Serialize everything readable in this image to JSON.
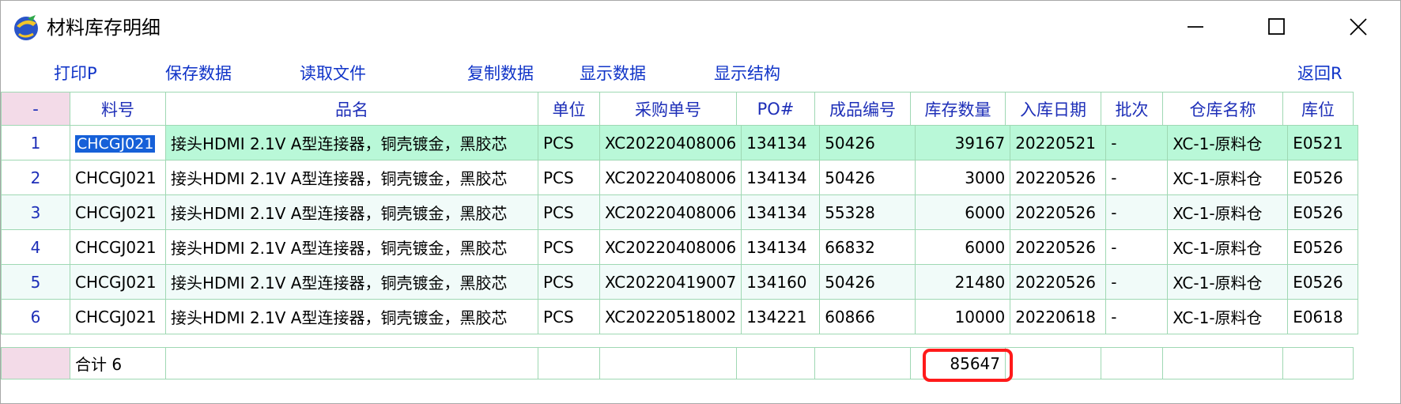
{
  "window": {
    "title": "材料库存明细"
  },
  "toolbar": [
    {
      "label": "打印P"
    },
    {
      "label": "保存数据"
    },
    {
      "label": "读取文件"
    },
    {
      "label": "复制数据"
    },
    {
      "label": "显示数据"
    },
    {
      "label": "显示结构"
    },
    {
      "label": "返回R"
    }
  ],
  "table": {
    "corner": "-",
    "columns": [
      "料号",
      "品名",
      "单位",
      "采购单号",
      "PO#",
      "成品编号",
      "库存数量",
      "入库日期",
      "批次",
      "仓库名称",
      "库位"
    ],
    "rows": [
      {
        "n": "1",
        "part": "CHCGJ021",
        "name": "接头HDMI 2.1V A型连接器，铜壳镀金，黑胶芯",
        "unit": "PCS",
        "po_no": "XC20220408006",
        "po": "134134",
        "product": "50426",
        "qty": "39167",
        "date": "20220521",
        "batch": "-",
        "wh": "XC-1-原料仓",
        "loc": "E0521"
      },
      {
        "n": "2",
        "part": "CHCGJ021",
        "name": "接头HDMI 2.1V A型连接器，铜壳镀金，黑胶芯",
        "unit": "PCS",
        "po_no": "XC20220408006",
        "po": "134134",
        "product": "50426",
        "qty": "3000",
        "date": "20220526",
        "batch": "-",
        "wh": "XC-1-原料仓",
        "loc": "E0526"
      },
      {
        "n": "3",
        "part": "CHCGJ021",
        "name": "接头HDMI 2.1V A型连接器，铜壳镀金，黑胶芯",
        "unit": "PCS",
        "po_no": "XC20220408006",
        "po": "134134",
        "product": "55328",
        "qty": "6000",
        "date": "20220526",
        "batch": "-",
        "wh": "XC-1-原料仓",
        "loc": "E0526"
      },
      {
        "n": "4",
        "part": "CHCGJ021",
        "name": "接头HDMI 2.1V A型连接器，铜壳镀金，黑胶芯",
        "unit": "PCS",
        "po_no": "XC20220408006",
        "po": "134134",
        "product": "66832",
        "qty": "6000",
        "date": "20220526",
        "batch": "-",
        "wh": "XC-1-原料仓",
        "loc": "E0526"
      },
      {
        "n": "5",
        "part": "CHCGJ021",
        "name": "接头HDMI 2.1V A型连接器，铜壳镀金，黑胶芯",
        "unit": "PCS",
        "po_no": "XC20220419007",
        "po": "134160",
        "product": "50426",
        "qty": "21480",
        "date": "20220526",
        "batch": "-",
        "wh": "XC-1-原料仓",
        "loc": "E0526"
      },
      {
        "n": "6",
        "part": "CHCGJ021",
        "name": "接头HDMI 2.1V A型连接器，铜壳镀金，黑胶芯",
        "unit": "PCS",
        "po_no": "XC20220518002",
        "po": "134221",
        "product": "60866",
        "qty": "10000",
        "date": "20220618",
        "batch": "-",
        "wh": "XC-1-原料仓",
        "loc": "E0618"
      }
    ],
    "summary": {
      "label": "合计 6",
      "qty": "85647"
    }
  },
  "colors": {
    "accent_text": "#1e2fb8",
    "selected_row": "#b9f8d8",
    "selection": "#1660d8",
    "highlight": "#ff1a1a"
  },
  "icons": [
    "app-icon",
    "minimize-icon",
    "maximize-icon",
    "close-icon"
  ]
}
